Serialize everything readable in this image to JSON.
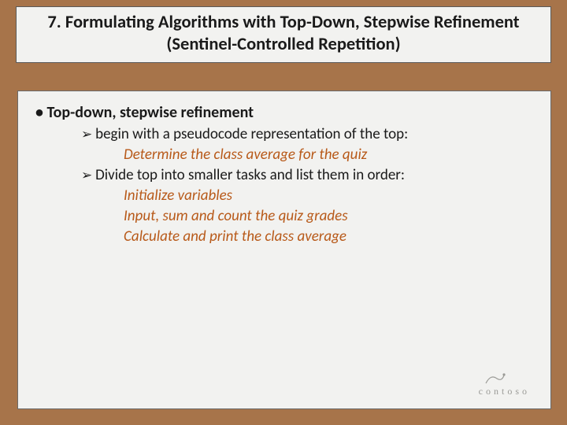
{
  "title": "7. Formulating Algorithms with Top-Down, Stepwise Refinement (Sentinel-Controlled Repetition)",
  "content": {
    "heading": "Top-down, stepwise refinement",
    "sub1": "begin with a pseudocode representation of the top:",
    "example1": "Determine the class average for the quiz",
    "sub2": "Divide top into smaller tasks and list them in order:",
    "example2a": "Initialize variables",
    "example2b": "Input, sum and count the quiz grades",
    "example2c": "Calculate and print the class average"
  },
  "logo": "contoso"
}
